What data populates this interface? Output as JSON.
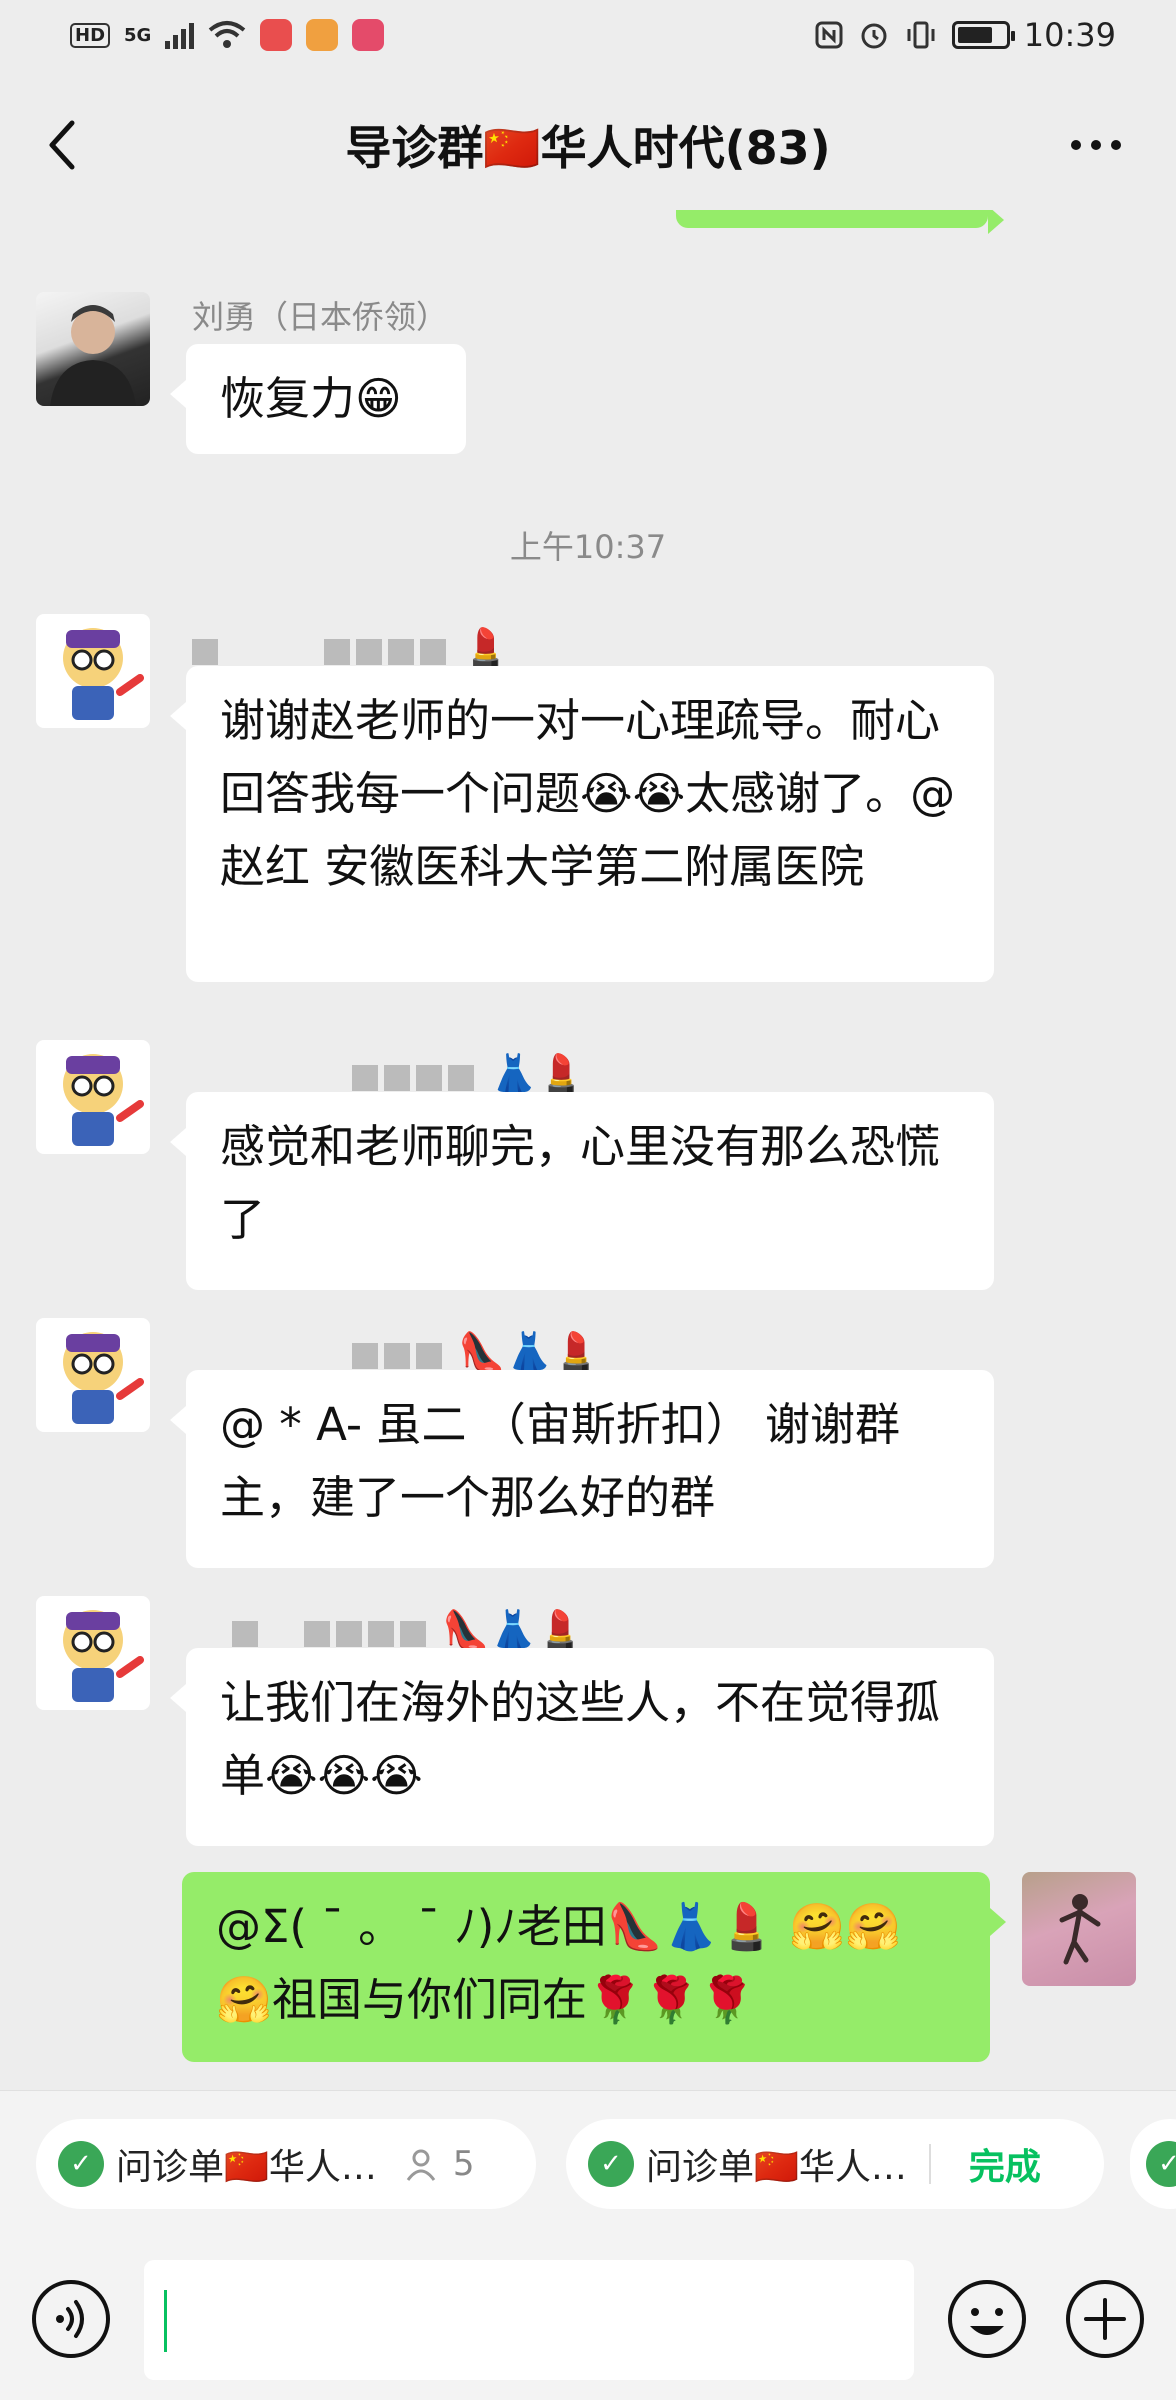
{
  "status_bar": {
    "left_badge": "HD",
    "network": "5G",
    "time": "10:39",
    "battery_level": 0.75
  },
  "header": {
    "back_icon": "chevron-left-icon",
    "title": "导诊群🇨🇳华人时代(83)",
    "more_icon": "more-dots-icon"
  },
  "messages": [
    {
      "sender": "刘勇（日本侨领）",
      "text": "恢复力😁"
    },
    {
      "timestamp": "上午10:37"
    },
    {
      "sender_suffix": "💄",
      "text": "谢谢赵老师的一对一心理疏导。耐心回答我每一个问题😭😭太感谢了。@ 赵红 安徽医科大学第二附属医院"
    },
    {
      "sender_suffix": "👗💄",
      "text": "感觉和老师聊完，心里没有那么恐慌了"
    },
    {
      "sender_suffix": "👠👗💄",
      "text": "@ *   A- 虽二 （宙斯折扣） 谢谢群主，建了一个那么好的群"
    },
    {
      "sender_suffix": "👠👗💄",
      "text": "让我们在海外的这些人，不在觉得孤单😭😭😭"
    },
    {
      "mine": true,
      "text": "@Σ( ¯ 。 ¯ ﾉ)ﾉ老田👠👗💄 🤗🤗🤗祖国与你们同在🌹🌹🌹"
    }
  ],
  "quick_tabs": [
    {
      "label": "问诊单🇨🇳华人…",
      "count": "5"
    },
    {
      "label": "问诊单🇨🇳华人…",
      "status": "完成"
    }
  ],
  "input": {
    "placeholder": "",
    "value": ""
  },
  "colors": {
    "background": "#ededed",
    "my_bubble": "#95ec69",
    "accent": "#07c160"
  }
}
